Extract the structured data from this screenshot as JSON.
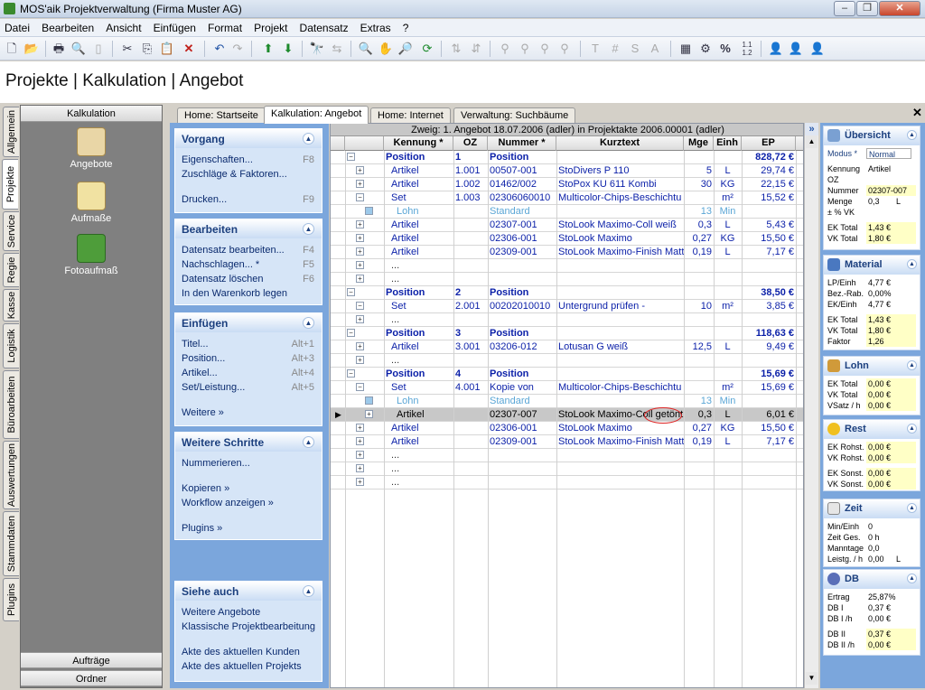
{
  "window": {
    "title": "MOS'aik Projektverwaltung (Firma Muster AG)"
  },
  "menu": [
    "Datei",
    "Bearbeiten",
    "Ansicht",
    "Einfügen",
    "Format",
    "Projekt",
    "Datensatz",
    "Extras",
    "?"
  ],
  "headline": "Projekte | Kalkulation | Angebot",
  "vtabs": [
    "Allgemein",
    "Projekte",
    "Service",
    "Regie",
    "Kasse",
    "Logistik",
    "Büroarbeiten",
    "Auswertungen",
    "Stammdaten",
    "Plugins"
  ],
  "leftpanel": {
    "header": "Kalkulation",
    "items": [
      "Angebote",
      "Aufmaße",
      "Fotoaufmaß"
    ],
    "bottom": [
      "Aufträge",
      "Ordner"
    ]
  },
  "tabs": [
    "Home: Startseite",
    "Kalkulation: Angebot",
    "Home: Internet",
    "Verwaltung: Suchbäume"
  ],
  "taskpane": {
    "vorgang": {
      "title": "Vorgang",
      "items": [
        {
          "label": "Eigenschaften...",
          "key": "F8"
        },
        {
          "label": "Zuschläge & Faktoren...",
          "key": ""
        },
        {
          "label": "Drucken...",
          "key": "F9"
        }
      ]
    },
    "bearbeiten": {
      "title": "Bearbeiten",
      "items": [
        {
          "label": "Datensatz bearbeiten...",
          "key": "F4"
        },
        {
          "label": "Nachschlagen...  *",
          "key": "F5"
        },
        {
          "label": "Datensatz löschen",
          "key": "F6"
        },
        {
          "label": "In den Warenkorb legen",
          "key": ""
        }
      ]
    },
    "einfuegen": {
      "title": "Einfügen",
      "items": [
        {
          "label": "Titel...",
          "key": "Alt+1"
        },
        {
          "label": "Position...",
          "key": "Alt+3"
        },
        {
          "label": "Artikel...",
          "key": "Alt+4"
        },
        {
          "label": "Set/Leistung...",
          "key": "Alt+5"
        },
        {
          "label": "Weitere »",
          "key": ""
        }
      ]
    },
    "weitere": {
      "title": "Weitere Schritte",
      "items": [
        "Nummerieren...",
        "Kopieren »",
        "Workflow anzeigen »",
        "Plugins »"
      ]
    },
    "siehe": {
      "title": "Siehe auch",
      "items": [
        "Weitere Angebote",
        "Klassische Projektbearbeitung",
        "Akte des aktuellen Kunden",
        "Akte des aktuellen Projekts"
      ]
    }
  },
  "grid": {
    "caption": "Zweig: 1. Angebot 18.07.2006 (adler) in Projektakte 2006.00001 (adler)",
    "columns": [
      "Kennung *",
      "OZ",
      "Nummer *",
      "Kurztext",
      "Mge",
      "Einh",
      "EP"
    ],
    "rows": [
      {
        "k": "Position",
        "oz": "1",
        "nr": "Position",
        "kt": "",
        "mge": "",
        "einh": "",
        "ep": "828,72 €",
        "t": "pos"
      },
      {
        "k": "Artikel",
        "oz": "1.001",
        "nr": "00507-001",
        "kt": "StoDivers P 110",
        "mge": "5",
        "einh": "L",
        "ep": "29,74 €",
        "t": "art"
      },
      {
        "k": "Artikel",
        "oz": "1.002",
        "nr": "01462/002",
        "kt": "StoPox KU 611 Kombi",
        "mge": "30",
        "einh": "KG",
        "ep": "22,15 €",
        "t": "art"
      },
      {
        "k": "Set",
        "oz": "1.003",
        "nr": "02306060010",
        "kt": "Multicolor-Chips-Beschichtu",
        "mge": "",
        "einh": "m²",
        "ep": "15,52 €",
        "t": "art"
      },
      {
        "k": "Lohn",
        "oz": "",
        "nr": "Standard",
        "kt": "",
        "mge": "13",
        "einh": "Min",
        "ep": "",
        "t": "lohn"
      },
      {
        "k": "Artikel",
        "oz": "",
        "nr": "02307-001",
        "kt": "StoLook Maximo-Coll weiß",
        "mge": "0,3",
        "einh": "L",
        "ep": "5,43 €",
        "t": "art"
      },
      {
        "k": "Artikel",
        "oz": "",
        "nr": "02306-001",
        "kt": "StoLook Maximo",
        "mge": "0,27",
        "einh": "KG",
        "ep": "15,50 €",
        "t": "art"
      },
      {
        "k": "Artikel",
        "oz": "",
        "nr": "02309-001",
        "kt": "StoLook Maximo-Finish Matt",
        "mge": "0,19",
        "einh": "L",
        "ep": "7,17 €",
        "t": "art"
      },
      {
        "k": "...",
        "oz": "",
        "nr": "",
        "kt": "",
        "mge": "",
        "einh": "",
        "ep": "",
        "t": "dots"
      },
      {
        "k": "...",
        "oz": "",
        "nr": "",
        "kt": "",
        "mge": "",
        "einh": "",
        "ep": "",
        "t": "dots"
      },
      {
        "k": "Position",
        "oz": "2",
        "nr": "Position",
        "kt": "",
        "mge": "",
        "einh": "",
        "ep": "38,50 €",
        "t": "pos"
      },
      {
        "k": "Set",
        "oz": "2.001",
        "nr": "00202010010",
        "kt": "Untergrund prüfen -",
        "mge": "10",
        "einh": "m²",
        "ep": "3,85 €",
        "t": "art"
      },
      {
        "k": "...",
        "oz": "",
        "nr": "",
        "kt": "",
        "mge": "",
        "einh": "",
        "ep": "",
        "t": "dots"
      },
      {
        "k": "Position",
        "oz": "3",
        "nr": "Position",
        "kt": "",
        "mge": "",
        "einh": "",
        "ep": "118,63 €",
        "t": "pos"
      },
      {
        "k": "Artikel",
        "oz": "3.001",
        "nr": "03206-012",
        "kt": "Lotusan G weiß",
        "mge": "12,5",
        "einh": "L",
        "ep": "9,49 €",
        "t": "art"
      },
      {
        "k": "...",
        "oz": "",
        "nr": "",
        "kt": "",
        "mge": "",
        "einh": "",
        "ep": "",
        "t": "dots"
      },
      {
        "k": "Position",
        "oz": "4",
        "nr": "Position",
        "kt": "",
        "mge": "",
        "einh": "",
        "ep": "15,69 €",
        "t": "pos"
      },
      {
        "k": "Set",
        "oz": "4.001",
        "nr": "Kopie von",
        "kt": "Multicolor-Chips-Beschichtu",
        "mge": "",
        "einh": "m²",
        "ep": "15,69 €",
        "t": "art"
      },
      {
        "k": "Lohn",
        "oz": "",
        "nr": "Standard",
        "kt": "",
        "mge": "13",
        "einh": "Min",
        "ep": "",
        "t": "lohn"
      },
      {
        "k": "Artikel",
        "oz": "",
        "nr": "02307-007",
        "kt": "StoLook Maximo-Coll getönt",
        "mge": "0,3",
        "einh": "L",
        "ep": "6,01 €",
        "t": "sel"
      },
      {
        "k": "Artikel",
        "oz": "",
        "nr": "02306-001",
        "kt": "StoLook Maximo",
        "mge": "0,27",
        "einh": "KG",
        "ep": "15,50 €",
        "t": "art"
      },
      {
        "k": "Artikel",
        "oz": "",
        "nr": "02309-001",
        "kt": "StoLook Maximo-Finish Matt",
        "mge": "0,19",
        "einh": "L",
        "ep": "7,17 €",
        "t": "art"
      },
      {
        "k": "...",
        "oz": "",
        "nr": "",
        "kt": "",
        "mge": "",
        "einh": "",
        "ep": "",
        "t": "dots"
      },
      {
        "k": "...",
        "oz": "",
        "nr": "",
        "kt": "",
        "mge": "",
        "einh": "",
        "ep": "",
        "t": "dots"
      },
      {
        "k": "...",
        "oz": "",
        "nr": "",
        "kt": "",
        "mge": "",
        "einh": "",
        "ep": "",
        "t": "dots"
      }
    ]
  },
  "right": {
    "uebersicht": {
      "title": "Übersicht",
      "modus_label": "Modus *",
      "modus": "Normal",
      "rows": [
        [
          "Kennung",
          "Artikel",
          ""
        ],
        [
          "OZ",
          "",
          ""
        ],
        [
          "Nummer",
          "02307-007",
          ""
        ],
        [
          "Menge",
          "0,3",
          "L"
        ],
        [
          "± % VK",
          "",
          ""
        ]
      ],
      "totals": [
        [
          "EK Total",
          "1,43 €"
        ],
        [
          "VK Total",
          "1,80 €"
        ]
      ]
    },
    "material": {
      "title": "Material",
      "rows": [
        [
          "LP/Einh",
          "4,77 €"
        ],
        [
          "Bez.-Rab.",
          "0,00%"
        ],
        [
          "EK/Einh",
          "4,77 €"
        ]
      ],
      "totals": [
        [
          "EK Total",
          "1,43 €"
        ],
        [
          "VK Total",
          "1,80 €"
        ],
        [
          "Faktor",
          "1,26"
        ]
      ]
    },
    "lohn": {
      "title": "Lohn",
      "rows": [
        [
          "EK Total",
          "0,00 €"
        ],
        [
          "VK Total",
          "0,00 €"
        ],
        [
          "VSatz / h",
          "0,00 €"
        ]
      ]
    },
    "rest": {
      "title": "Rest",
      "rows1": [
        [
          "EK Rohst.",
          "0,00 €"
        ],
        [
          "VK Rohst.",
          "0,00 €"
        ]
      ],
      "rows2": [
        [
          "EK Sonst.",
          "0,00 €"
        ],
        [
          "VK Sonst.",
          "0,00 €"
        ]
      ]
    },
    "zeit": {
      "title": "Zeit",
      "rows": [
        [
          "Min/Einh",
          "0",
          ""
        ],
        [
          "Zeit Ges.",
          "0 h",
          ""
        ],
        [
          "Manntage",
          "0,0",
          ""
        ],
        [
          "Leistg. / h",
          "0,00",
          "L"
        ]
      ]
    },
    "db": {
      "title": "DB",
      "rows": [
        [
          "Ertrag",
          "25,87%"
        ],
        [
          "DB I",
          "0,37 €"
        ],
        [
          "DB I /h",
          "0,00 €"
        ]
      ],
      "rows2": [
        [
          "DB II",
          "0,37 €"
        ],
        [
          "DB II /h",
          "0,00 €"
        ]
      ]
    }
  }
}
